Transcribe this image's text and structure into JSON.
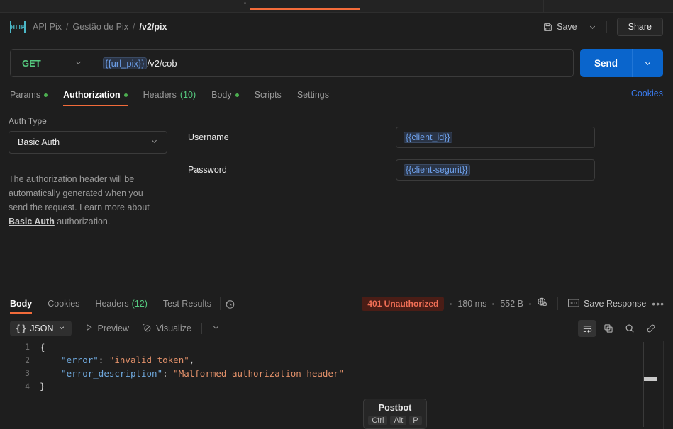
{
  "window": {
    "tabstrip": {
      "active_tab_indicator": true
    }
  },
  "header": {
    "icon": "http-protocol-icon",
    "icon_label": "HTTP",
    "breadcrumb": [
      {
        "label": "API Pix",
        "current": false
      },
      {
        "label": "Gestão de Pix",
        "current": false
      },
      {
        "label": "/v2/pix",
        "current": true
      }
    ],
    "separator": "/",
    "save_label": "Save",
    "share_label": "Share"
  },
  "request": {
    "method": "GET",
    "url_variable": "{{url_pix}}",
    "url_path": "/v2/cob",
    "send_label": "Send",
    "tabs": [
      {
        "label": "Params",
        "dot": true,
        "count": "",
        "active": false
      },
      {
        "label": "Authorization",
        "dot": true,
        "count": "",
        "active": true
      },
      {
        "label": "Headers",
        "dot": false,
        "count": "(10)",
        "active": false
      },
      {
        "label": "Body",
        "dot": true,
        "count": "",
        "active": false
      },
      {
        "label": "Scripts",
        "dot": false,
        "count": "",
        "active": false
      },
      {
        "label": "Settings",
        "dot": false,
        "count": "",
        "active": false
      }
    ],
    "cookies_link": "Cookies"
  },
  "authorization": {
    "auth_type_label": "Auth Type",
    "auth_type_value": "Basic Auth",
    "help_text_1": "The authorization header will be automatically generated when you send the request. Learn more about ",
    "help_link": "Basic Auth",
    "help_text_2": " authorization.",
    "fields": [
      {
        "label": "Username",
        "value": "{{client_id}}"
      },
      {
        "label": "Password",
        "value": "{{client-segurit}}"
      }
    ]
  },
  "response": {
    "tabs": [
      {
        "label": "Body",
        "count": "",
        "active": true
      },
      {
        "label": "Cookies",
        "count": "",
        "active": false
      },
      {
        "label": "Headers",
        "count": "(12)",
        "active": false
      },
      {
        "label": "Test Results",
        "count": "",
        "active": false
      }
    ],
    "history_icon": "clock-history-icon",
    "status": "401 Unauthorized",
    "time": "180 ms",
    "size": "552 B",
    "network_icon": "globe-lock-icon",
    "save_response_label": "Save Response",
    "more_label": "•••",
    "toolbar": {
      "format": "JSON",
      "preview_label": "Preview",
      "visualize_label": "Visualize",
      "icons": [
        "wrap-lines-icon",
        "copy-icon",
        "search-icon",
        "link-icon"
      ]
    },
    "body_lines": [
      {
        "num": "1",
        "tokens": [
          {
            "t": "{",
            "c": "k-punc"
          }
        ]
      },
      {
        "num": "2",
        "tokens": [
          {
            "t": "    ",
            "c": "k-punc"
          },
          {
            "t": "\"error\"",
            "c": "k-key"
          },
          {
            "t": ": ",
            "c": "k-colon"
          },
          {
            "t": "\"invalid_token\"",
            "c": "k-str"
          },
          {
            "t": ",",
            "c": "k-punc"
          }
        ]
      },
      {
        "num": "3",
        "tokens": [
          {
            "t": "    ",
            "c": "k-punc"
          },
          {
            "t": "\"error_description\"",
            "c": "k-key"
          },
          {
            "t": ": ",
            "c": "k-colon"
          },
          {
            "t": "\"Malformed authorization header\"",
            "c": "k-str"
          }
        ]
      },
      {
        "num": "4",
        "tokens": [
          {
            "t": "}",
            "c": "k-punc"
          }
        ]
      }
    ]
  },
  "postbot": {
    "title": "Postbot",
    "keys": [
      "Ctrl",
      "Alt",
      "P"
    ]
  },
  "colors": {
    "accent_orange": "#f26b3a",
    "send_blue": "#0a65cc",
    "method_green": "#55c97f",
    "status_red_bg": "#4a1d16",
    "status_red_fg": "#f26f56",
    "link_blue": "#3a7bee",
    "variable_blue": "#6d9fe8"
  }
}
